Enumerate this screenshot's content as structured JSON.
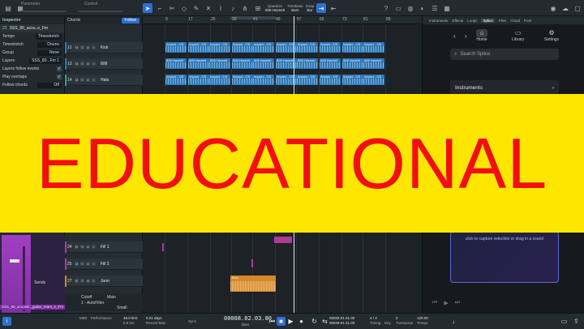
{
  "toolbar": {
    "parameter_label": "Parameter",
    "control_label": "Control",
    "quantize": {
      "label": "Quantize",
      "value": "808 Hazeelt"
    },
    "timebase": {
      "label": "Timebase",
      "value": "Bars"
    },
    "snap": {
      "label": "Snap",
      "value": "Bar"
    },
    "accent_color": "#2e6fd0"
  },
  "inspector": {
    "title": "Inspector",
    "track_number": "22",
    "track_name": "SSS_80_acou..e_Fm",
    "rows": [
      {
        "label": "Tempo",
        "value": "Timestretch"
      },
      {
        "label": "Timestretch",
        "value": "Drums"
      },
      {
        "label": "Group",
        "value": "None"
      },
      {
        "label": "Layers",
        "value": "SSS_80...Fm 1"
      }
    ],
    "checks": [
      {
        "label": "Layers follow events",
        "checked": "✓"
      },
      {
        "label": "Play overlaps",
        "checked": "✓"
      }
    ],
    "follow_chords": {
      "label": "Follow chords",
      "value": "Off"
    },
    "sends_label": "Sends",
    "channel_name": "SSS_80_acoustic_guitar_ream_e_Fm"
  },
  "tracklist": {
    "chords_label": "Chords",
    "follow_label": "Follow",
    "tracks": [
      {
        "number": "12",
        "name": "Kick",
        "color": "#2f78b6"
      },
      {
        "number": "13",
        "name": "808",
        "color": "#2f78b6"
      },
      {
        "number": "14",
        "name": "Hats",
        "color": "#2aa59a"
      },
      {
        "number": "24",
        "name": "Fill 1",
        "color": "#b13a95"
      },
      {
        "number": "25",
        "name": "Fill 2",
        "color": "#b13a95"
      },
      {
        "number": "27",
        "name": "Juno",
        "color": "#d7862a"
      }
    ],
    "bottom": {
      "cutoff": "Cutoff",
      "main": "Main",
      "auto": "1 - AutoFilter",
      "small": "Small"
    }
  },
  "arrangement": {
    "ruler_numbers": [
      "1",
      "9",
      "17",
      "25",
      "33",
      "41",
      "49",
      "57",
      "65",
      "73",
      "81",
      "89"
    ],
    "clip_labels": {
      "impact": "Impact - OS",
      "hazeelt": "808 Hazeelt",
      "juno": "Juno"
    }
  },
  "splice": {
    "tabs": [
      "Instruments",
      "Effects",
      "Loops",
      "Splice",
      "Files",
      "Cloud",
      "Pool"
    ],
    "active_tab": "Splice",
    "nav": {
      "home": "Home",
      "library": "Library",
      "settings": "Settings"
    },
    "search_placeholder": "Search Splice",
    "instruments_label": "Instruments",
    "drop_text": "click to capture selection or drag in a sound"
  },
  "transport": {
    "midi": "MIDI",
    "performance": "Performance",
    "sample_rate": "48.0 kHz",
    "latency": "5.8 ms",
    "record_days": "5.01 days",
    "record_max": "Record Max",
    "sync": "Sync",
    "position": "00008.02.03.80",
    "position_unit": "Bars",
    "loop_start": "00033.01.01.00",
    "loop_end": "00049.01.01.00",
    "signature": "4 / 4",
    "timing": "Timing",
    "key": "Key",
    "transpose_value": "0",
    "transpose": "Transpose",
    "tempo_value": "120.00",
    "tempo": "Tempo"
  },
  "overlay": {
    "text": "EDUCATIONAL",
    "background": "#ffe600",
    "color": "#f10f0f"
  }
}
